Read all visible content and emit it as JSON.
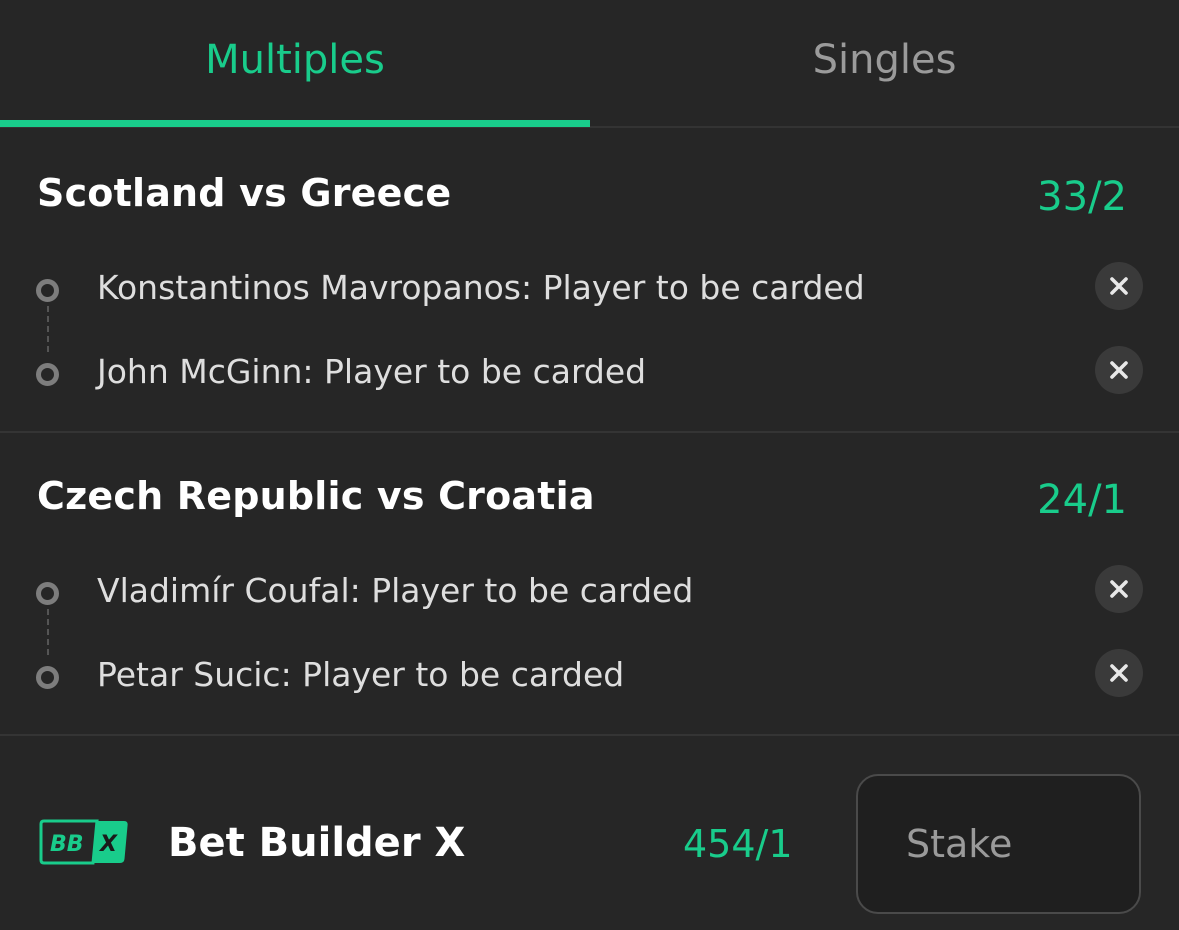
{
  "tabs": [
    {
      "label": "Multiples",
      "active": true
    },
    {
      "label": "Singles",
      "active": false
    }
  ],
  "events": [
    {
      "title": "Scotland vs Greece",
      "odds": "33/2",
      "selections": [
        {
          "label": "Konstantinos Mavropanos: Player to be carded"
        },
        {
          "label": "John McGinn: Player to be carded"
        }
      ]
    },
    {
      "title": "Czech Republic vs Croatia",
      "odds": "24/1",
      "selections": [
        {
          "label": "Vladimír Coufal: Player to be carded"
        },
        {
          "label": "Petar Sucic: Player to be carded"
        }
      ]
    }
  ],
  "bet_builder": {
    "logo_text_left": "BB",
    "logo_text_right": "X",
    "title": "Bet Builder X",
    "odds": "454/1",
    "stake_placeholder": "Stake"
  },
  "icons": {
    "remove": "close-icon",
    "selection_marker": "ring-dot-icon",
    "logo": "bet-builder-x-logo"
  },
  "colors": {
    "accent": "#19cc8b",
    "background": "#262626",
    "remove_button_bg": "#3a3a3a"
  }
}
